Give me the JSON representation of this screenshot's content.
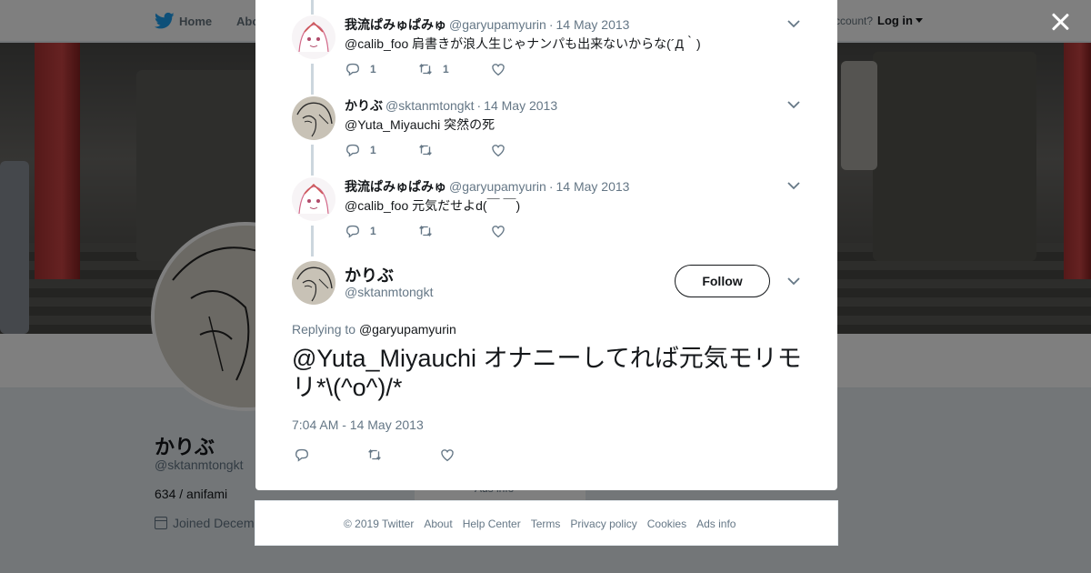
{
  "topnav": {
    "home_label": "Home",
    "about_label": "Abo",
    "account_text": "ccount?",
    "login_label": "Log in"
  },
  "profile": {
    "name": "かりぶ",
    "handle": "@sktanmtongkt",
    "bio": "634 / anifami",
    "joined": "Joined Decem",
    "center_box_text": "Ads info"
  },
  "replies": [
    {
      "name": "我流ぱみゅぱみゅ",
      "handle": "@garyupamyurin",
      "time": "14 May 2013",
      "text": "@calib_foo 肩書きが浪人生じゃナンパも出来ないからな(´Д｀)",
      "reply_count": "1",
      "retweet_count": "1",
      "like_count": "",
      "avatar": "girl-avatar"
    },
    {
      "name": "かりぶ",
      "handle": "@sktanmtongkt",
      "time": "14 May 2013",
      "text": "@Yuta_Miyauchi 突然の死",
      "reply_count": "1",
      "retweet_count": "",
      "like_count": "",
      "avatar": "sketch-avatar"
    },
    {
      "name": "我流ぱみゅぱみゅ",
      "handle": "@garyupamyurin",
      "time": "14 May 2013",
      "text": "@calib_foo 元気だせよd(￣ ￣)",
      "reply_count": "1",
      "retweet_count": "",
      "like_count": "",
      "avatar": "girl-avatar"
    }
  ],
  "main_tweet": {
    "name": "かりぶ",
    "handle": "@sktanmtongkt",
    "follow_label": "Follow",
    "replying_prefix": "Replying to",
    "replying_to": "@garyupamyurin",
    "text": "@Yuta_Miyauchi オナニーしてれば元気モリモリ*\\(^o^)/*",
    "timestamp": "7:04 AM - 14 May 2013"
  },
  "footer": {
    "links": [
      "© 2019 Twitter",
      "About",
      "Help Center",
      "Terms",
      "Privacy policy",
      "Cookies",
      "Ads info"
    ]
  },
  "colors": {
    "link_blue": "#1da1f2",
    "text_dark": "#14171a",
    "text_gray": "#657786",
    "overlay": "rgba(0,0,0,0.5)"
  },
  "icons": [
    "twitter-bird-icon",
    "close-icon",
    "chevron-down-icon",
    "reply-icon",
    "retweet-icon",
    "like-icon",
    "calendar-icon"
  ]
}
